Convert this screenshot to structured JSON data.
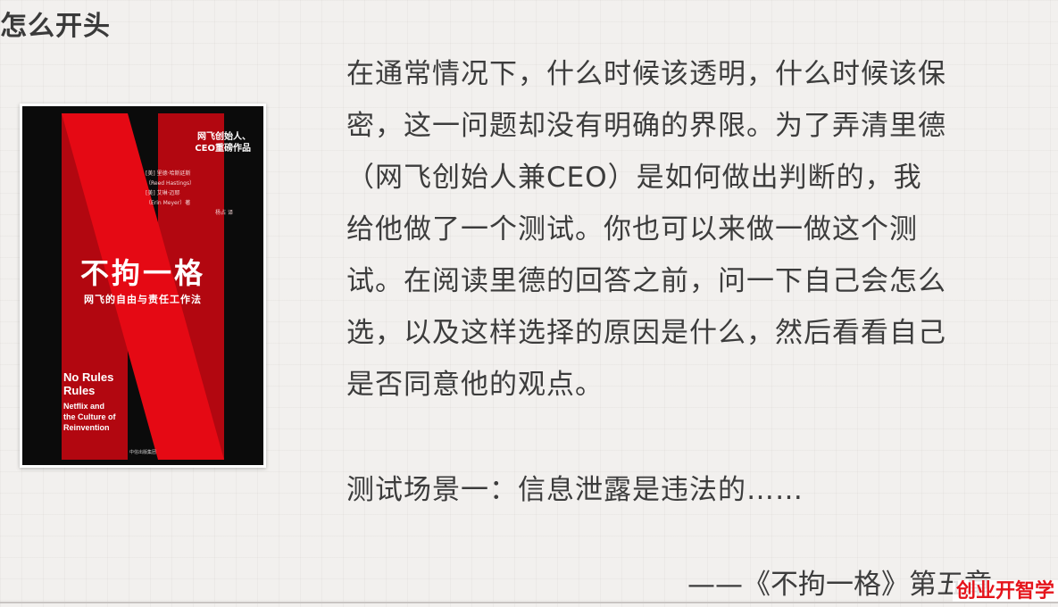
{
  "section": {
    "title": "怎么开头"
  },
  "book": {
    "tagline": [
      "网飞创始人、",
      "CEO重磅作品"
    ],
    "authors": [
      "[美] 里德·哈斯廷斯",
      "（Reed Hastings）",
      "[美] 艾琳·迈耶",
      "（Erin Meyer）著"
    ],
    "translator": "杨占 译",
    "title": "不拘一格",
    "subtitle": "网飞的自由与责任工作法",
    "en_title": [
      "No Rules",
      "Rules"
    ],
    "en_subtitle": [
      "Netflix and",
      "the Culture of",
      "Reinvention"
    ],
    "publisher": "中信出版集团",
    "colors": {
      "cover_background": "#0b0b0b",
      "logo_red": "#e50914"
    }
  },
  "quote": {
    "lines": [
      "在通常情况下，什么时候该透明，什么时候该保",
      "密，这一问题却没有明确的界限。为了弄清里德",
      "（网飞创始人兼CEO）是如何做出判断的，我",
      "给他做了一个测试。你也可以来做一做这个测",
      "试。在阅读里德的回答之前，问一下自己会怎么",
      "选，以及这样选择的原因是什么，然后看看自己",
      "是否同意他的观点。"
    ]
  },
  "scenario": "测试场景一：信息泄露是违法的……",
  "attribution": "——《不拘一格》第五章",
  "watermark": {
    "text": "创业开智学"
  }
}
